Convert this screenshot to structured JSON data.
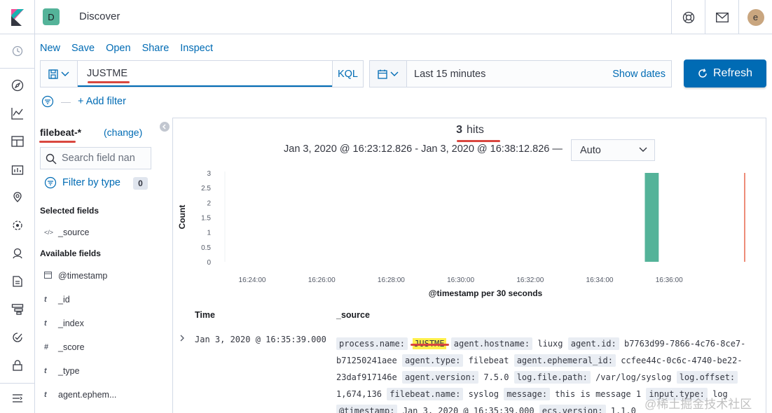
{
  "header": {
    "space_initial": "D",
    "title": "Discover",
    "user_initial": "e"
  },
  "menu": {
    "new": "New",
    "save": "Save",
    "open": "Open",
    "share": "Share",
    "inspect": "Inspect"
  },
  "query": {
    "value": "JUSTME",
    "language": "KQL"
  },
  "time": {
    "label": "Last 15 minutes",
    "show_dates": "Show dates"
  },
  "refresh_label": "Refresh",
  "filter": {
    "add_label": "+ Add filter"
  },
  "sidebar": {
    "index_pattern": "filebeat-*",
    "change_label": "(change)",
    "search_placeholder": "Search field nan",
    "filter_by_type": "Filter by type",
    "filter_count": "0",
    "selected_title": "Selected fields",
    "selected_fields": [
      {
        "type": "</>",
        "name": "_source"
      }
    ],
    "available_title": "Available fields",
    "available_fields": [
      {
        "type": "cal",
        "name": "@timestamp"
      },
      {
        "type": "t",
        "name": "_id"
      },
      {
        "type": "t",
        "name": "_index"
      },
      {
        "type": "#",
        "name": "_score"
      },
      {
        "type": "t",
        "name": "_type"
      },
      {
        "type": "t",
        "name": "agent.ephem..."
      }
    ]
  },
  "results": {
    "hits_count": "3",
    "hits_label": "hits",
    "range": "Jan 3, 2020 @ 16:23:12.826 - Jan 3, 2020 @ 16:38:12.826 —",
    "interval": "Auto",
    "col_time": "Time",
    "col_source": "_source",
    "row": {
      "time": "Jan 3, 2020 @ 16:35:39.000",
      "source": [
        {
          "k": "process.name:",
          "v": "JUSTME",
          "highlight": true
        },
        {
          "k": "agent.hostname:",
          "v": "liuxg"
        },
        {
          "k": "agent.id:",
          "v": "b7763d99-7866-4c76-8ce7-b71250241aee"
        },
        {
          "k": "agent.type:",
          "v": "filebeat"
        },
        {
          "k": "agent.ephemeral_id:",
          "v": "ccfee44c-0c6c-4740-be22-23daf917146e"
        },
        {
          "k": "agent.version:",
          "v": "7.5.0"
        },
        {
          "k": "log.file.path:",
          "v": "/var/log/syslog"
        },
        {
          "k": "log.offset:",
          "v": "1,674,136"
        },
        {
          "k": "filebeat.name:",
          "v": "syslog"
        },
        {
          "k": "message:",
          "v": "this is message 1"
        },
        {
          "k": "input.type:",
          "v": "log"
        },
        {
          "k": "@timestamp:",
          "v": "Jan 3, 2020 @ 16:35:39.000"
        },
        {
          "k": "ecs.version:",
          "v": "1.1.0"
        }
      ]
    }
  },
  "chart_data": {
    "type": "bar",
    "title": "",
    "xlabel": "@timestamp per 30 seconds",
    "ylabel": "Count",
    "x_ticks": [
      "16:24:00",
      "16:26:00",
      "16:28:00",
      "16:30:00",
      "16:32:00",
      "16:34:00",
      "16:36:00"
    ],
    "y_ticks": [
      "0",
      "0.5",
      "1",
      "1.5",
      "2",
      "2.5",
      "3"
    ],
    "ylim": [
      0,
      3
    ],
    "xlim": [
      "16:23:12.826",
      "16:38:12.826"
    ],
    "bars": [
      {
        "x": "16:35:30",
        "value": 3
      }
    ],
    "now_marker": "16:38:12.826",
    "bar_color": "#54b399",
    "marker_color": "#e7664c"
  },
  "watermark": "@稀土掘金技术社区",
  "colors": {
    "accent": "#006bb4",
    "highlight": "#fff04d"
  }
}
